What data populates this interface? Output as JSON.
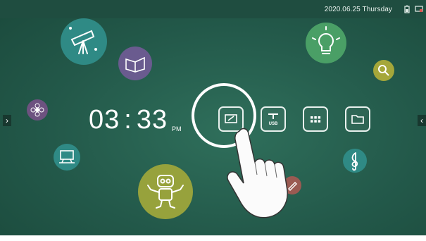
{
  "status_bar": {
    "datetime": "2020.06.25 Thursday",
    "icons": [
      "battery-icon",
      "screen-icon"
    ]
  },
  "clock": {
    "hours": "03",
    "separator": ":",
    "minutes": "33",
    "period": "PM"
  },
  "toolbar": {
    "tiles": [
      {
        "name": "whiteboard-tile",
        "icon": "whiteboard-icon"
      },
      {
        "name": "usb-tile",
        "icon": "usb-icon",
        "label": "USB"
      },
      {
        "name": "apps-tile",
        "icon": "grid-icon"
      },
      {
        "name": "files-tile",
        "icon": "folder-icon"
      }
    ]
  },
  "bubbles": [
    "telescope-bubble",
    "book-bubble",
    "lightbulb-bubble",
    "magnifier-bubble",
    "flower-bubble",
    "computer-bubble",
    "robot-bubble",
    "music-bubble",
    "pen-bubble"
  ],
  "colors": {
    "background": "#23594a",
    "teal": "#2f8a85",
    "olive": "#97a23c",
    "purple": "#6a5b8f",
    "green": "#4a9f66"
  },
  "nav": {
    "left_arrow": "›",
    "right_arrow": "‹"
  }
}
